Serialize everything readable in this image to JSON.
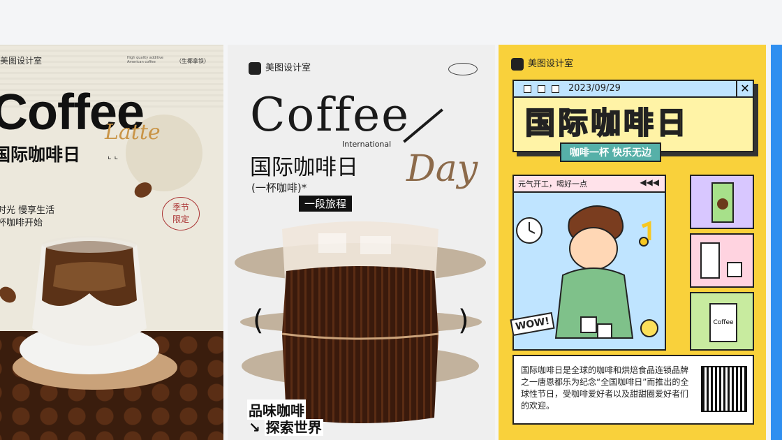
{
  "gallery": {
    "cards": [
      {
        "brand": "美图设计室",
        "small_note": "High quality additive American coffee",
        "series": "（生椰拿铁）",
        "title_en": "Coffee",
        "script": "Latte",
        "title_cn": "国际咖啡日",
        "arrows": "⌞ ⌞",
        "slogan_line1": "时光 慢享生活",
        "slogan_line2": "杯咖啡开始",
        "stamp": "季节\n限定"
      },
      {
        "brand": "美图设计室",
        "title_en": "Coffee",
        "subtitle_en": "International",
        "title_cn": "国际咖啡日",
        "script": "Day",
        "sub_cn": "(一杯咖啡)*",
        "tag": "一段旅程",
        "paren_left": "(",
        "paren_right": ")",
        "bottom_line1": "品味咖啡",
        "bottom_line2": "探索世界",
        "arrow": "↘"
      },
      {
        "brand": "美图设计室",
        "date": "2023/09/29",
        "title_cn": "国际咖啡日",
        "ribbon": "咖啡一杯  快乐无边",
        "scene_label": "元气开工，喝好一点",
        "play": "◀◀◀",
        "wow": "WOW!",
        "cup_label": "Coffee",
        "info_text": "国际咖啡日是全球的咖啡和烘焙食品连锁品牌之一唐恩都乐为纪念“全国咖啡日”而推出的全球性节日，受咖啡爱好者以及甜甜圈爱好者们的欢迎。"
      }
    ]
  },
  "colors": {
    "card3_bg": "#f9d13b",
    "accent_teal": "#56b0a8",
    "peek_card": "#2f8ff0"
  }
}
